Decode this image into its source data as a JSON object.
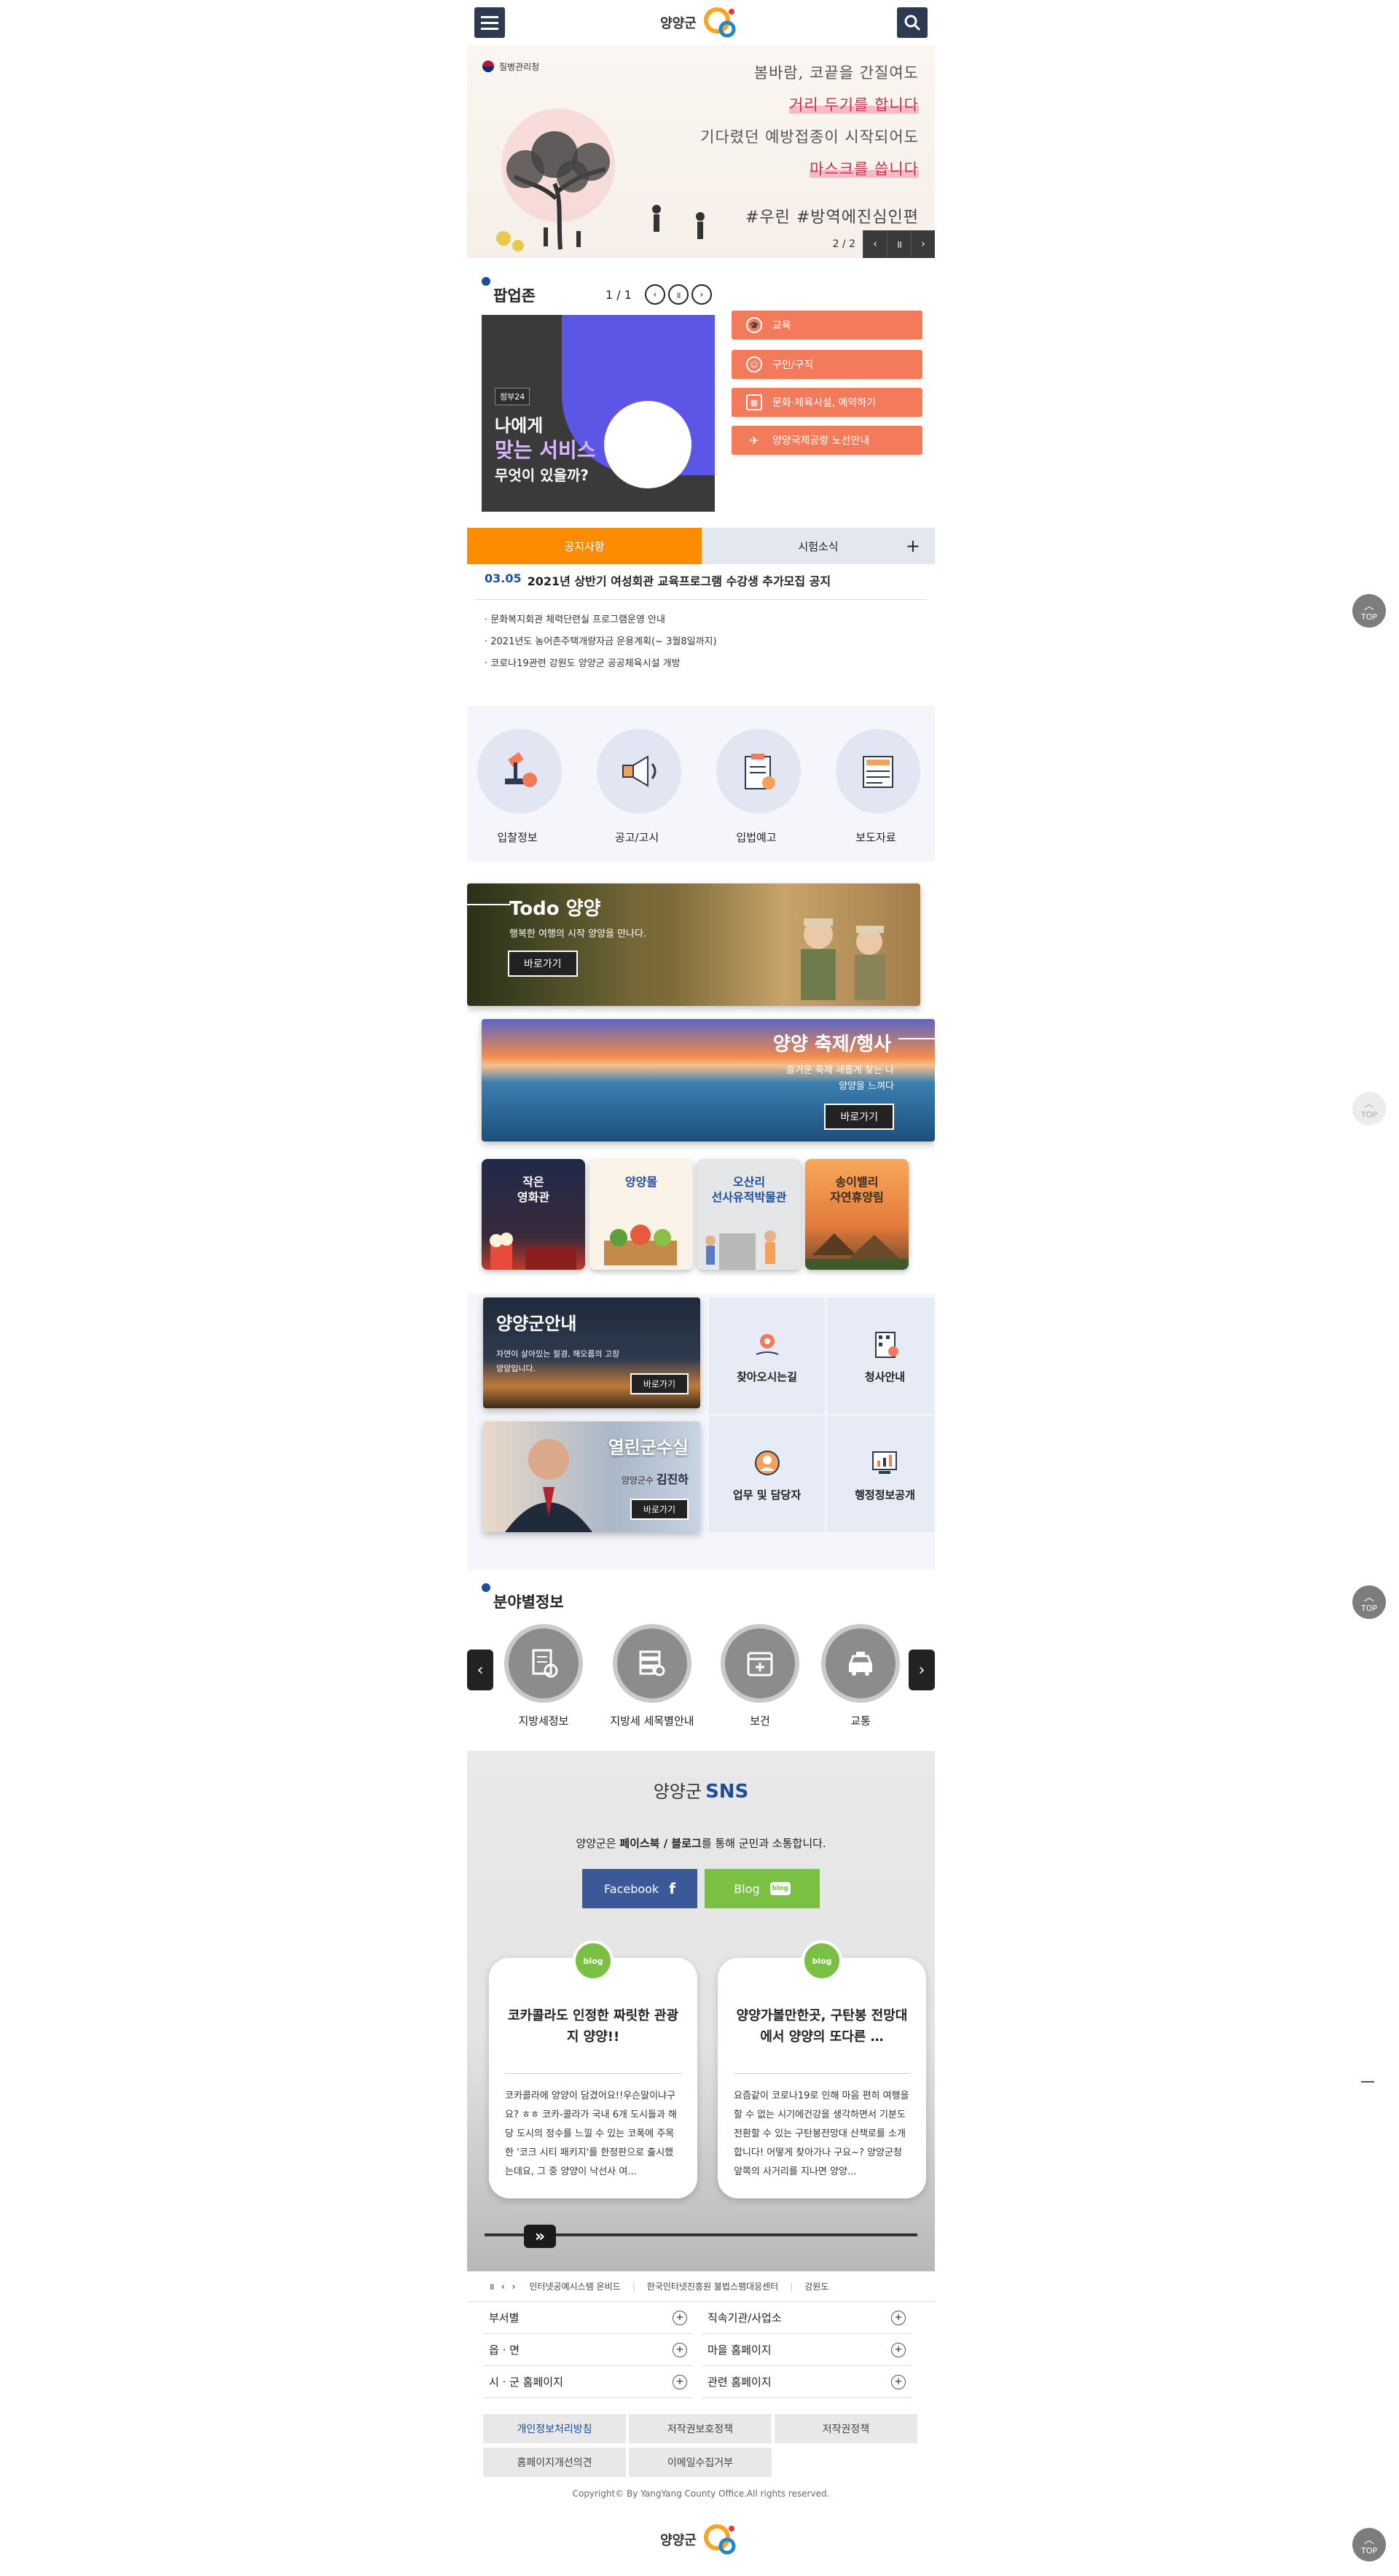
{
  "header": {
    "logo_text": "양양군",
    "menu_icon": "menu-icon",
    "search_icon": "search-icon"
  },
  "hero": {
    "agency": "질병관리청",
    "lines": [
      "봄바람, 코끝을 간질여도",
      "거리 두기를 합니다",
      "기다렸던 예방접종이 시작되어도",
      "마스크를 씁니다"
    ],
    "hashtag": "#우린 #방역에진심인편",
    "counter": "2 / 2"
  },
  "popup": {
    "title": "팝업존",
    "counter": "1 / 1",
    "image_badge": "정부24",
    "image_line1": "나에게",
    "image_line2": "맞는 서비스",
    "image_line3": "무엇이 있을까?",
    "buttons": [
      "교육",
      "구인/구직",
      "문화·체육시설, 예약하기",
      "양양국제공항 노선안내"
    ]
  },
  "notice": {
    "tab_active": "공지사항",
    "tab_other": "시험소식",
    "plus": "+",
    "featured_date": "03.05",
    "featured_title": "2021년 상반기 여성회관 교육프로그램 수강생 추가모집 공지",
    "items": [
      "문화복지회관 체력단련실 프로그램운영 안내",
      "2021년도 농어촌주택개량자금 운용계획(~ 3월8일까지)",
      "코로나19관련 강원도 양양군 공공체육시설 개방"
    ]
  },
  "quick": [
    "입찰정보",
    "공고/고시",
    "입법예고",
    "보도자료"
  ],
  "banners": {
    "todo_title": "Todo 양양",
    "todo_sub": "행복한 여행의 시작 양양을 만나다.",
    "festival_title": "양양 축제/행사",
    "festival_sub1": "즐거운 축제 새롭게 찾는 나",
    "festival_sub2": "양양을 느껴다",
    "go": "바로가기"
  },
  "cards": [
    {
      "title1": "작은",
      "title2": "영화관"
    },
    {
      "title1": "양양몰",
      "title2": ""
    },
    {
      "title1": "오산리",
      "title2": "선사유적박물관"
    },
    {
      "title1": "송이밸리",
      "title2": "자연휴양림"
    }
  ],
  "guide": {
    "title": "양양군안내",
    "sub1": "자연이 살아있는 절경, 해오름의 고장",
    "sub2": "양양입니다.",
    "mayor_title": "열린군수실",
    "mayor_prefix": "양양군수",
    "mayor_name": "김진하",
    "go": "바로가기",
    "grid": [
      "찾아오시는길",
      "청사안내",
      "업무 및 담당자",
      "행정정보공개"
    ]
  },
  "field": {
    "title": "분야별정보",
    "items": [
      "지방세정보",
      "지방세 세목별안내",
      "보건",
      "교통"
    ]
  },
  "sns": {
    "logo_text": "양양군",
    "logo_sns": "SNS",
    "desc_prefix": "양양군은 ",
    "desc_bold": "페이스북 / 블로그",
    "desc_suffix": "를 통해 군민과 소통합니다.",
    "facebook": "Facebook",
    "blog": "Blog",
    "badge": "blog",
    "cards": [
      {
        "title": "코카콜라도 인정한 짜릿한 관광지 양양!!",
        "body": "코카콜라에 양양이 담겼어요!!우슨말이냐구요? ㅎㅎ 코카-콜라가 국내 6개 도시들과 해당 도시의 정수를 느낄 수 있는 코폭에 주목한 '코크 시티 패키지'를 한정판으로 출시했는데요, 그 중 양양이 낙선사 여..."
      },
      {
        "title": "양양가볼만한곳, 구탄봉 전망대에서 양양의 또다른 …",
        "body": "요즘같이 코로나19로 인해 마음 편히 여행을 할 수 없는 시기에건강을 생각하면서 기분도 전환할 수 있는 구탄봉전망대 산책로를 소개합니다! 어떻게 찾아가나 구요~? 양양군청 앞쪽의 사거리를 지나면 양양..."
      }
    ]
  },
  "links": {
    "items": [
      "인터넷공예시스템 온비드",
      "한국인터넷진흥원 불법스팸대응센터",
      "강원도"
    ]
  },
  "footer": {
    "rows_left": [
      "부서별",
      "읍 · 면",
      "시 · 군 홈페이지"
    ],
    "rows_right": [
      "직속기관/사업소",
      "마을 홈페이지",
      "관련 홈페이지"
    ],
    "buttons": [
      "개인정보처리방침",
      "저작권보호정책",
      "저작권정책",
      "홈페이지개선의견",
      "이메일수집거부"
    ],
    "copyright": "Copyright© By YangYang County Office.All rights reserved.",
    "logo_text": "양양군"
  },
  "top_label": "TOP",
  "colors": {
    "accent": "#f47a5c",
    "notice_tab": "#ff8c00",
    "navy": "#2e3a4f",
    "facebook": "#3b5998",
    "blog": "#7ac143"
  }
}
